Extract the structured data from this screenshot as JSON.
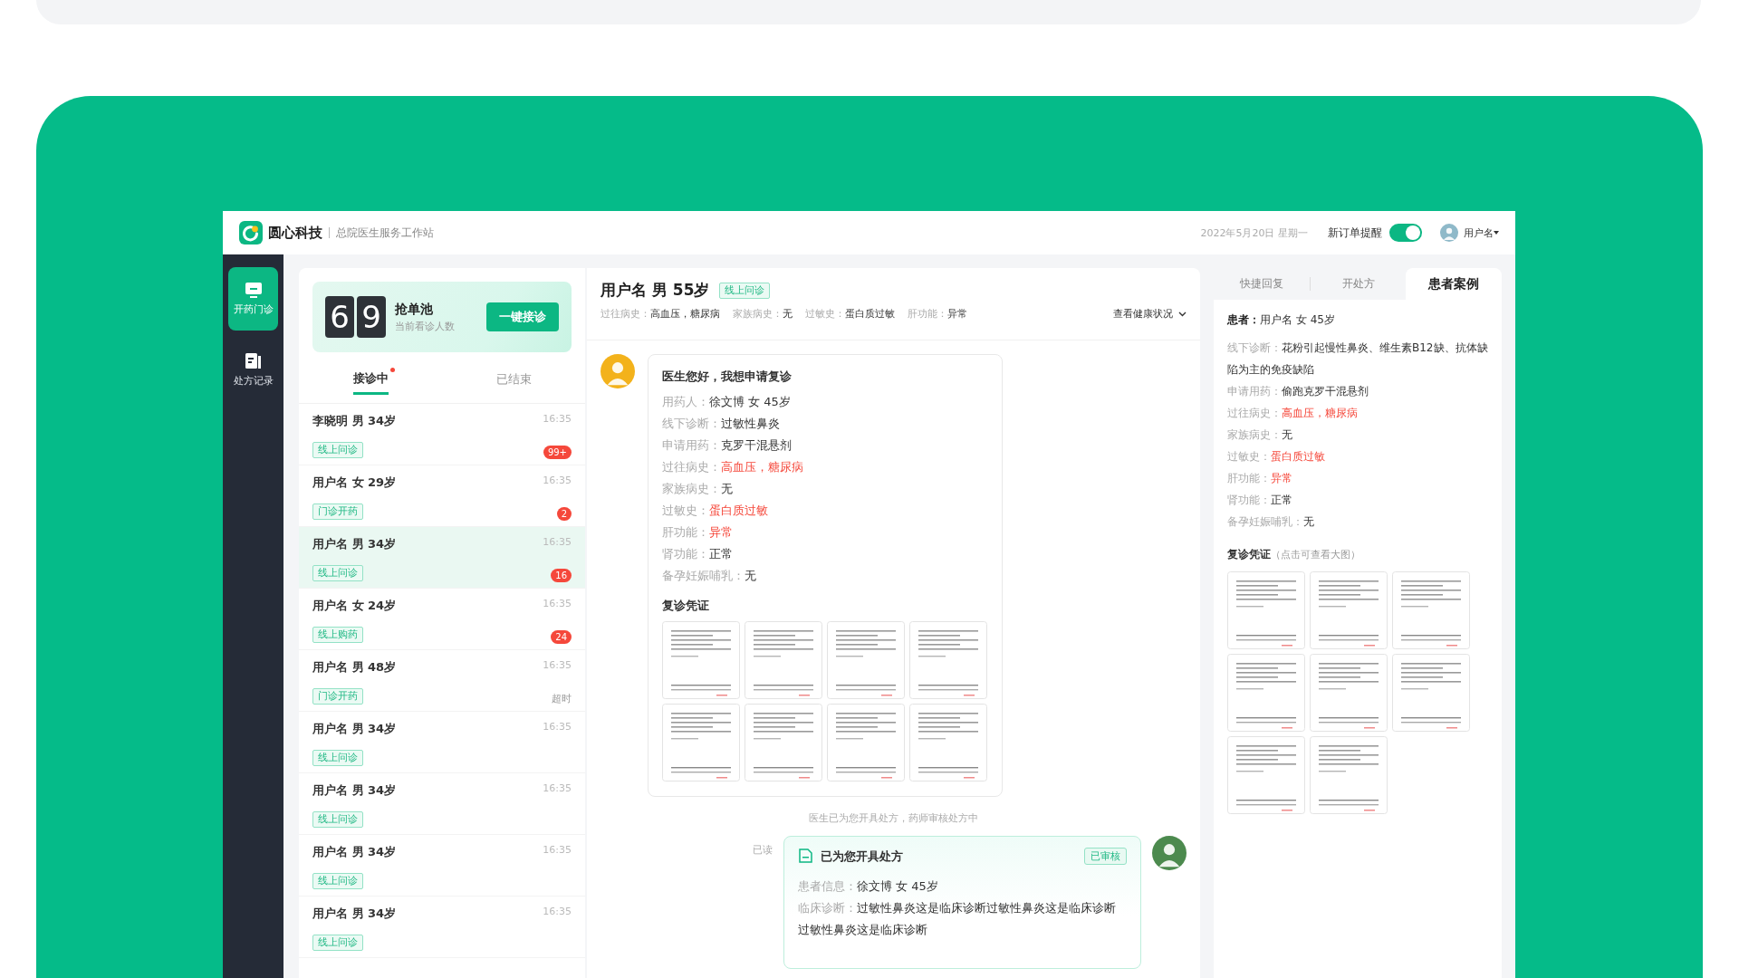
{
  "app": {
    "brand": "圆心科技",
    "subtitle": "总院医生服务工作站",
    "date": "2022年5月20日 星期一",
    "order_alert": {
      "label": "新订单提醒",
      "on": true
    },
    "user": "用户名"
  },
  "sidebar": [
    {
      "label": "开药门诊",
      "kind": "monitor",
      "selected": true
    },
    {
      "label": "处方记录",
      "kind": "document",
      "selected": false
    }
  ],
  "pool": {
    "digits": [
      "6",
      "9"
    ],
    "title": "抢单池",
    "caption": "当前看诊人数",
    "button": "一键接诊"
  },
  "queue_tabs": [
    {
      "label": "接诊中",
      "selected": true,
      "dot": true
    },
    {
      "label": "已结束",
      "selected": false,
      "dot": false
    }
  ],
  "patients": [
    {
      "name": "李晓明 男 34岁",
      "tag": "线上问诊",
      "time": "16:35",
      "badge": "99+",
      "selected": false
    },
    {
      "name": "用户名 女 29岁",
      "tag": "门诊开药",
      "time": "16:35",
      "badge": "2",
      "selected": false
    },
    {
      "name": "用户名 男 34岁",
      "tag": "线上问诊",
      "time": "16:35",
      "badge": "16",
      "selected": true
    },
    {
      "name": "用户名 女 24岁",
      "tag": "线上购药",
      "time": "16:35",
      "badge": "24",
      "selected": false
    },
    {
      "name": "用户名 男 48岁",
      "tag": "门诊开药",
      "time": "16:35",
      "status": "超时",
      "selected": false
    },
    {
      "name": "用户名 男 34岁",
      "tag": "线上问诊",
      "time": "16:35",
      "selected": false
    },
    {
      "name": "用户名 男 34岁",
      "tag": "线上问诊",
      "time": "16:35",
      "selected": false
    },
    {
      "name": "用户名 男 34岁",
      "tag": "线上问诊",
      "time": "16:35",
      "selected": false
    },
    {
      "name": "用户名 男 34岁",
      "tag": "线上问诊",
      "time": "16:35",
      "selected": false
    }
  ],
  "consultation": {
    "title": "用户名 男 55岁",
    "tag": "线上问诊",
    "summary": [
      {
        "label": "过往病史：",
        "value": "高血压，糖尿病"
      },
      {
        "label": "家族病史：",
        "value": "无"
      },
      {
        "label": "过敏史：",
        "value": "蛋白质过敏"
      },
      {
        "label": "肝功能：",
        "value": "异常"
      }
    ],
    "health_menu": "查看健康状况"
  },
  "request": {
    "heading": "医生您好，我想申请复诊",
    "fields": [
      {
        "label": "用药人：",
        "value": "徐文博 女 45岁",
        "alert": false
      },
      {
        "label": "线下诊断：",
        "value": "过敏性鼻炎",
        "alert": false
      },
      {
        "label": "申请用药：",
        "value": "克罗干混悬剂",
        "alert": false
      },
      {
        "label": "过往病史：",
        "value": "高血压，糖尿病",
        "alert": true
      },
      {
        "label": "家族病史：",
        "value": "无",
        "alert": false
      },
      {
        "label": "过敏史：",
        "value": "蛋白质过敏",
        "alert": true
      },
      {
        "label": "肝功能：",
        "value": "异常",
        "alert": true
      },
      {
        "label": "肾功能：",
        "value": "正常",
        "alert": false
      },
      {
        "label": "备孕妊娠哺乳：",
        "value": "无",
        "alert": false
      }
    ],
    "voucher_title": "复诊凭证"
  },
  "notice": "医生已为您开具处方，药师审核处方中",
  "prescription": {
    "read": "已读",
    "title": "已为您开具处方",
    "status": "已审核",
    "fields": [
      {
        "label": "患者信息：",
        "value": "徐文博 女 45岁"
      },
      {
        "label": "临床诊断：",
        "value": "过敏性鼻炎这是临床诊断过敏性鼻炎这是临床诊断过敏性鼻炎这是临床诊断"
      }
    ]
  },
  "case_tabs": [
    {
      "label": "快捷回复",
      "selected": false
    },
    {
      "label": "开处方",
      "selected": false
    },
    {
      "label": "患者案例",
      "selected": true
    }
  ],
  "case": {
    "patient_label": "患者：",
    "patient": "用户名 女 45岁",
    "fields": [
      {
        "label": "线下诊断：",
        "value": "花粉引起慢性鼻炎、维生素B12缺、抗体缺陷为主的免疫缺陷",
        "alert": false
      },
      {
        "label": "申请用药：",
        "value": "偷跑克罗干混悬剂",
        "alert": false
      },
      {
        "label": "过往病史：",
        "value": "高血压，糖尿病",
        "alert": true
      },
      {
        "label": "家族病史：",
        "value": "无",
        "alert": false
      },
      {
        "label": "过敏史：",
        "value": "蛋白质过敏",
        "alert": true
      },
      {
        "label": "肝功能：",
        "value": "异常",
        "alert": true
      },
      {
        "label": "肾功能：",
        "value": "正常",
        "alert": false
      },
      {
        "label": "备孕妊娠哺乳：",
        "value": "无",
        "alert": false
      }
    ],
    "voucher_title": "复诊凭证",
    "voucher_hint": "（点击可查看大图）"
  }
}
